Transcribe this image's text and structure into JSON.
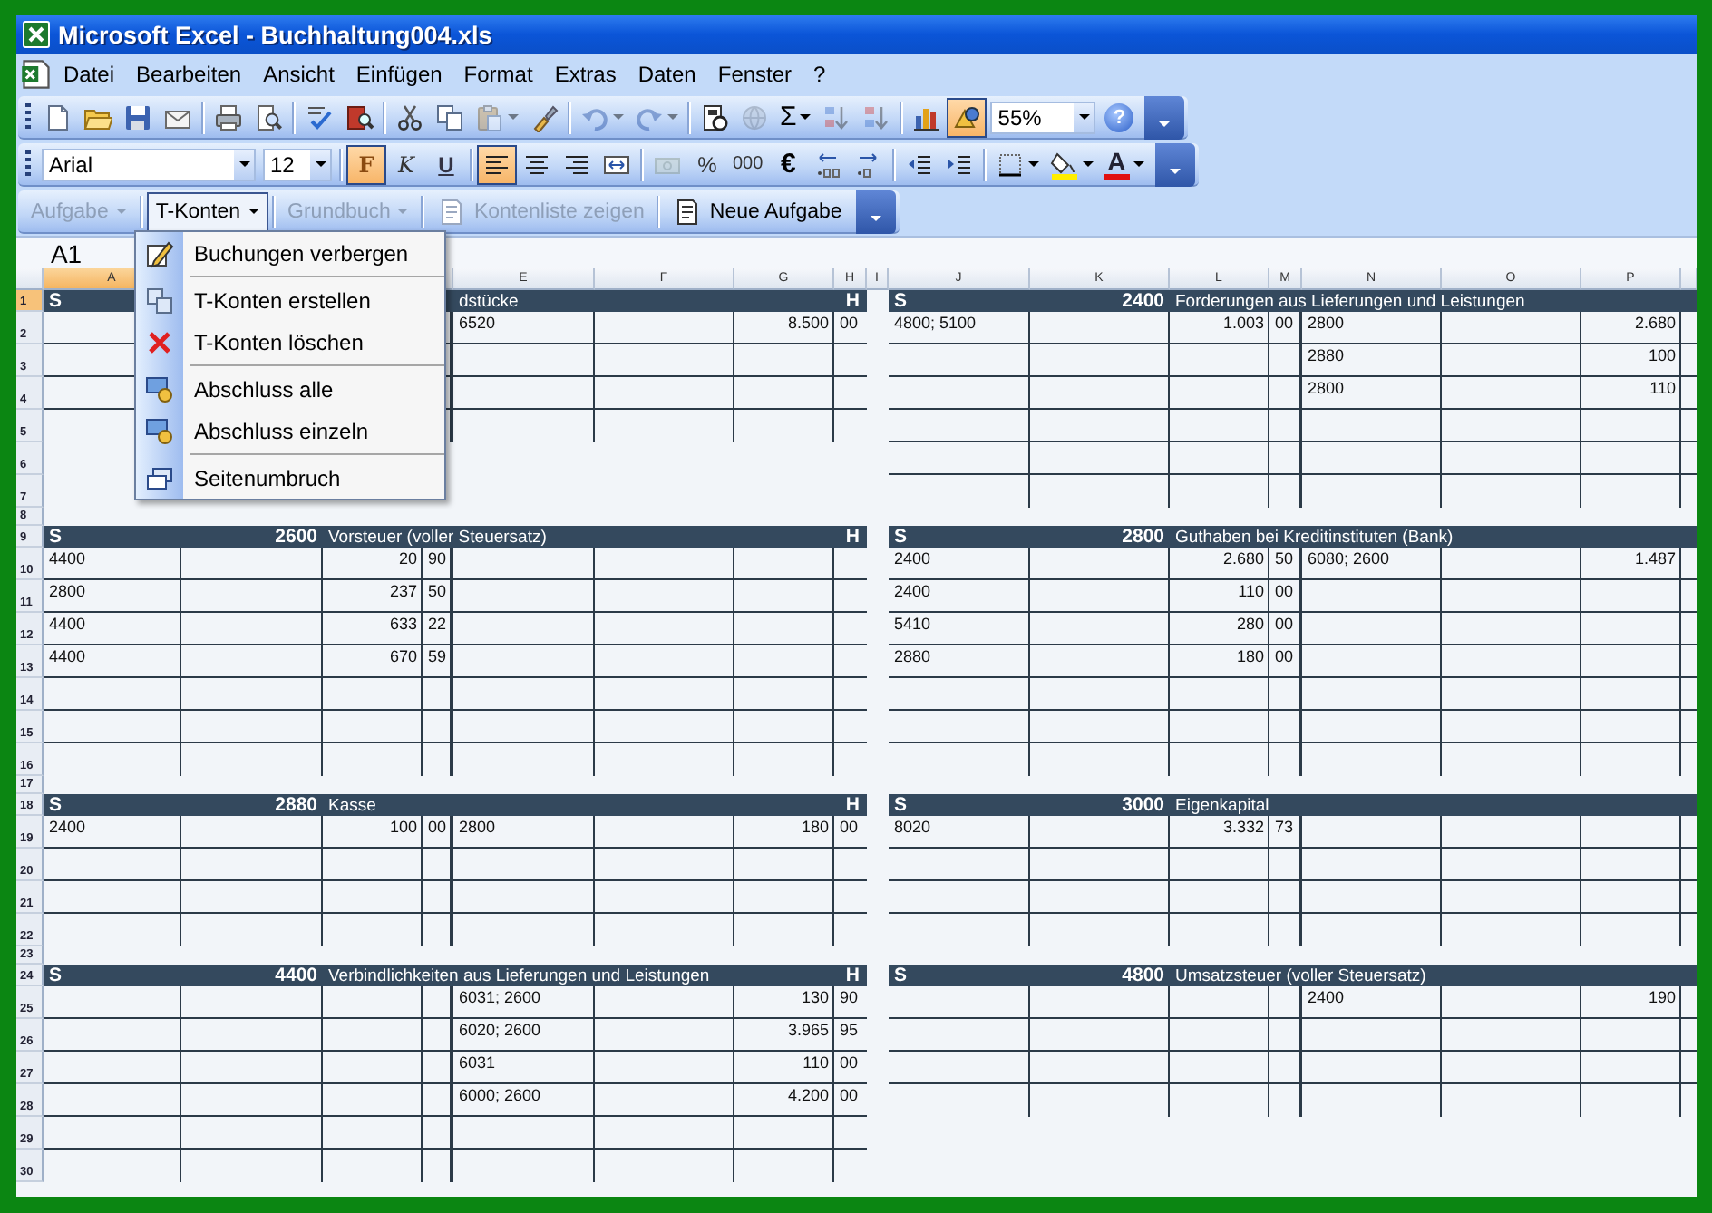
{
  "window": {
    "title": "Microsoft Excel - Buchhaltung004.xls"
  },
  "menu_bar": [
    "Datei",
    "Bearbeiten",
    "Ansicht",
    "Einfügen",
    "Format",
    "Extras",
    "Daten",
    "Fenster",
    "?"
  ],
  "standard_toolbar": {
    "zoom": "55%",
    "buttons": [
      {
        "kind": "icon",
        "pressed": false,
        "disabled": false,
        "dropdown": false
      },
      {
        "kind": "icon",
        "pressed": false,
        "disabled": false,
        "dropdown": false
      },
      {
        "kind": "icon",
        "pressed": false,
        "disabled": false,
        "dropdown": false
      },
      {
        "kind": "icon",
        "pressed": false,
        "disabled": false,
        "dropdown": false
      },
      {
        "kind": "icon",
        "pressed": false,
        "disabled": false,
        "dropdown": false
      },
      {
        "kind": "icon",
        "pressed": false,
        "disabled": false,
        "dropdown": false
      },
      {
        "kind": "icon",
        "pressed": false,
        "disabled": false,
        "dropdown": false
      },
      {
        "kind": "icon",
        "pressed": false,
        "disabled": false,
        "dropdown": false
      },
      {
        "kind": "icon",
        "pressed": false,
        "disabled": false,
        "dropdown": false
      },
      {
        "kind": "icon",
        "pressed": false,
        "disabled": false,
        "dropdown": false
      },
      {
        "kind": "icon",
        "pressed": false,
        "disabled": true,
        "dropdown": true
      },
      {
        "kind": "icon",
        "pressed": false,
        "disabled": false,
        "dropdown": false
      },
      {
        "kind": "icon",
        "pressed": false,
        "disabled": true,
        "dropdown": true
      },
      {
        "kind": "icon",
        "pressed": false,
        "disabled": true,
        "dropdown": true
      },
      {
        "kind": "icon",
        "pressed": false,
        "disabled": false,
        "dropdown": false
      },
      {
        "kind": "icon",
        "pressed": false,
        "disabled": true,
        "dropdown": false
      },
      {
        "kind": "text",
        "label": "Σ",
        "pressed": false,
        "disabled": false,
        "dropdown": true
      },
      {
        "kind": "icon",
        "pressed": false,
        "disabled": true,
        "dropdown": false
      },
      {
        "kind": "icon",
        "pressed": false,
        "disabled": true,
        "dropdown": false
      },
      {
        "kind": "icon",
        "pressed": false,
        "disabled": false,
        "dropdown": false
      },
      {
        "kind": "icon",
        "pressed": true,
        "disabled": false,
        "dropdown": false
      },
      {
        "kind": "round_text",
        "label": "?",
        "pressed": false,
        "disabled": false,
        "dropdown": false
      }
    ]
  },
  "formatting_toolbar": {
    "font": "Arial",
    "size": "12",
    "buttons": [
      {
        "kind": "text",
        "label": "F",
        "pressed": true,
        "disabled": false,
        "dropdown": false
      },
      {
        "kind": "text",
        "label": "K",
        "pressed": false,
        "disabled": false,
        "dropdown": false
      },
      {
        "kind": "text",
        "label": "U",
        "pressed": false,
        "disabled": false,
        "dropdown": false
      },
      {
        "kind": "icon",
        "pressed": true,
        "disabled": false,
        "dropdown": false
      },
      {
        "kind": "icon",
        "pressed": false,
        "disabled": false,
        "dropdown": false
      },
      {
        "kind": "icon",
        "pressed": false,
        "disabled": false,
        "dropdown": false
      },
      {
        "kind": "icon",
        "pressed": false,
        "disabled": false,
        "dropdown": false
      },
      {
        "kind": "icon",
        "pressed": false,
        "disabled": true,
        "dropdown": false
      },
      {
        "kind": "text",
        "label": "%",
        "pressed": false,
        "disabled": false,
        "dropdown": false
      },
      {
        "kind": "text",
        "label": "000",
        "pressed": false,
        "disabled": false,
        "dropdown": false
      },
      {
        "kind": "text",
        "label": "€",
        "pressed": false,
        "disabled": false,
        "dropdown": false
      },
      {
        "kind": "icon",
        "pressed": false,
        "disabled": false,
        "dropdown": false
      },
      {
        "kind": "icon",
        "pressed": false,
        "disabled": false,
        "dropdown": false
      },
      {
        "kind": "icon",
        "pressed": false,
        "disabled": false,
        "dropdown": false
      },
      {
        "kind": "icon",
        "pressed": false,
        "disabled": false,
        "dropdown": false
      },
      {
        "kind": "icon",
        "pressed": false,
        "disabled": false,
        "dropdown": true
      },
      {
        "kind": "icon",
        "pressed": false,
        "disabled": false,
        "dropdown": true
      },
      {
        "kind": "color_text",
        "label": "A",
        "pressed": false,
        "disabled": false,
        "dropdown": true
      }
    ]
  },
  "task_toolbar": {
    "buttons": [
      {
        "label": "Aufgabe",
        "icon": false,
        "dropdown": true,
        "disabled": true,
        "open": false
      },
      {
        "label": "T-Konten",
        "icon": false,
        "dropdown": true,
        "disabled": false,
        "open": true
      },
      {
        "label": "Grundbuch",
        "icon": false,
        "dropdown": true,
        "disabled": true,
        "open": false
      },
      {
        "label": "Kontenliste zeigen",
        "icon": true,
        "dropdown": false,
        "disabled": true,
        "open": false
      },
      {
        "label": "Neue Aufgabe",
        "icon": true,
        "dropdown": false,
        "disabled": false,
        "open": false
      }
    ]
  },
  "formula_bar": {
    "name_box": "A1"
  },
  "sheet": {
    "columns": [
      {
        "kind": "column",
        "label": "A",
        "selected": true
      },
      {
        "kind": "covered"
      },
      {
        "kind": "covered"
      },
      {
        "kind": "covered"
      },
      {
        "kind": "column",
        "label": "E",
        "selected": false
      },
      {
        "kind": "column",
        "label": "F",
        "selected": false
      },
      {
        "kind": "column",
        "label": "G",
        "selected": false
      },
      {
        "kind": "column",
        "label": "H",
        "selected": false
      },
      {
        "kind": "column",
        "label": "I",
        "selected": false
      },
      {
        "kind": "column",
        "label": "J",
        "selected": false
      },
      {
        "kind": "column",
        "label": "K",
        "selected": false
      },
      {
        "kind": "column",
        "label": "L",
        "selected": false
      },
      {
        "kind": "column",
        "label": "M",
        "selected": false
      },
      {
        "kind": "column",
        "label": "N",
        "selected": false
      },
      {
        "kind": "column",
        "label": "O",
        "selected": false
      },
      {
        "kind": "column",
        "label": "P",
        "selected": false
      }
    ],
    "rows": [
      {
        "label": "1",
        "selected": true
      },
      {
        "label": "2",
        "selected": false
      },
      {
        "label": "3",
        "selected": false
      },
      {
        "label": "4",
        "selected": false
      },
      {
        "label": "5",
        "selected": false
      },
      {
        "label": "6",
        "selected": false
      },
      {
        "label": "7",
        "selected": false
      },
      {
        "label": "8",
        "selected": false
      },
      {
        "label": "9",
        "selected": false
      },
      {
        "label": "10",
        "selected": false
      },
      {
        "label": "11",
        "selected": false
      },
      {
        "label": "12",
        "selected": false
      },
      {
        "label": "13",
        "selected": false
      },
      {
        "label": "14",
        "selected": false
      },
      {
        "label": "15",
        "selected": false
      },
      {
        "label": "16",
        "selected": false
      },
      {
        "label": "17",
        "selected": false
      },
      {
        "label": "18",
        "selected": false
      },
      {
        "label": "19",
        "selected": false
      },
      {
        "label": "20",
        "selected": false
      },
      {
        "label": "21",
        "selected": false
      },
      {
        "label": "22",
        "selected": false
      },
      {
        "label": "23",
        "selected": false
      },
      {
        "label": "24",
        "selected": false
      },
      {
        "label": "25",
        "selected": false
      },
      {
        "label": "26",
        "selected": false
      },
      {
        "label": "27",
        "selected": false
      },
      {
        "label": "28",
        "selected": false
      },
      {
        "label": "29",
        "selected": false
      },
      {
        "label": "30",
        "selected": false
      }
    ],
    "account_rows": [
      {
        "left": {
          "debit_side": "S",
          "credit_side": "H",
          "name": "dstücke",
          "name_covered": true,
          "lines": [
            {
              "kind": "entry",
              "credit": {
                "account": "6520",
                "amount": "8.500",
                "cents": "00"
              }
            },
            {
              "kind": "blank"
            },
            {
              "kind": "blank"
            },
            {
              "kind": "blank"
            }
          ]
        },
        "right": {
          "debit_side": "S",
          "number": "2400",
          "name": "Forderungen aus Lieferungen und Leistungen",
          "lines": [
            {
              "kind": "entry",
              "debit": {
                "account": "4800; 5100",
                "amount": "1.003",
                "cents": "00"
              },
              "credit": {
                "account": "2800",
                "amount": "2.680"
              }
            },
            {
              "kind": "entry",
              "credit": {
                "account": "2880",
                "amount": "100"
              }
            },
            {
              "kind": "entry",
              "credit": {
                "account": "2800",
                "amount": "110"
              }
            },
            {
              "kind": "blank"
            },
            {
              "kind": "blank"
            },
            {
              "kind": "blank"
            }
          ]
        }
      },
      {
        "left": {
          "debit_side": "S",
          "credit_side": "H",
          "number": "2600",
          "name": "Vorsteuer (voller Steuersatz)",
          "lines": [
            {
              "kind": "entry",
              "debit": {
                "account": "4400",
                "amount": "20",
                "cents": "90"
              }
            },
            {
              "kind": "entry",
              "debit": {
                "account": "2800",
                "amount": "237",
                "cents": "50"
              }
            },
            {
              "kind": "entry",
              "debit": {
                "account": "4400",
                "amount": "633",
                "cents": "22"
              }
            },
            {
              "kind": "entry",
              "debit": {
                "account": "4400",
                "amount": "670",
                "cents": "59"
              }
            },
            {
              "kind": "blank"
            },
            {
              "kind": "blank"
            },
            {
              "kind": "blank"
            }
          ]
        },
        "right": {
          "debit_side": "S",
          "number": "2800",
          "name": "Guthaben bei Kreditinstituten (Bank)",
          "lines": [
            {
              "kind": "entry",
              "debit": {
                "account": "2400",
                "amount": "2.680",
                "cents": "50"
              },
              "credit": {
                "account": "6080; 2600",
                "amount": "1.487"
              }
            },
            {
              "kind": "entry",
              "debit": {
                "account": "2400",
                "amount": "110",
                "cents": "00"
              }
            },
            {
              "kind": "entry",
              "debit": {
                "account": "5410",
                "amount": "280",
                "cents": "00"
              }
            },
            {
              "kind": "entry",
              "debit": {
                "account": "2880",
                "amount": "180",
                "cents": "00"
              }
            },
            {
              "kind": "blank"
            },
            {
              "kind": "blank"
            },
            {
              "kind": "blank"
            }
          ]
        }
      },
      {
        "left": {
          "debit_side": "S",
          "credit_side": "H",
          "number": "2880",
          "name": "Kasse",
          "lines": [
            {
              "kind": "entry",
              "debit": {
                "account": "2400",
                "amount": "100",
                "cents": "00"
              },
              "credit": {
                "account": "2800",
                "amount": "180",
                "cents": "00"
              }
            },
            {
              "kind": "blank"
            },
            {
              "kind": "blank"
            },
            {
              "kind": "blank"
            }
          ]
        },
        "right": {
          "debit_side": "S",
          "number": "3000",
          "name": "Eigenkapital",
          "lines": [
            {
              "kind": "entry",
              "debit": {
                "account": "8020",
                "amount": "3.332",
                "cents": "73"
              }
            },
            {
              "kind": "blank"
            },
            {
              "kind": "blank"
            },
            {
              "kind": "blank"
            }
          ]
        }
      },
      {
        "left": {
          "debit_side": "S",
          "credit_side": "H",
          "number": "4400",
          "name": "Verbindlichkeiten aus Lieferungen und Leistungen",
          "lines": [
            {
              "kind": "entry",
              "credit": {
                "account": "6031; 2600",
                "amount": "130",
                "cents": "90"
              }
            },
            {
              "kind": "entry",
              "credit": {
                "account": "6020; 2600",
                "amount": "3.965",
                "cents": "95"
              }
            },
            {
              "kind": "entry",
              "credit": {
                "account": "6031",
                "amount": "110",
                "cents": "00"
              }
            },
            {
              "kind": "entry",
              "credit": {
                "account": "6000; 2600",
                "amount": "4.200",
                "cents": "00"
              }
            },
            {
              "kind": "blank"
            },
            {
              "kind": "blank"
            }
          ]
        },
        "right": {
          "debit_side": "S",
          "number": "4800",
          "name": "Umsatzsteuer (voller Steuersatz)",
          "lines": [
            {
              "kind": "entry",
              "credit": {
                "account": "2400",
                "amount": "190"
              }
            },
            {
              "kind": "blank"
            },
            {
              "kind": "blank"
            },
            {
              "kind": "blank"
            }
          ]
        }
      }
    ]
  },
  "t_konten_menu": {
    "items": [
      {
        "kind": "item",
        "label": "Buchungen verbergen"
      },
      {
        "kind": "separator"
      },
      {
        "kind": "item",
        "label": "T-Konten erstellen"
      },
      {
        "kind": "item",
        "label": "T-Konten löschen"
      },
      {
        "kind": "separator"
      },
      {
        "kind": "item",
        "label": "Abschluss alle"
      },
      {
        "kind": "item",
        "label": "Abschluss einzeln"
      },
      {
        "kind": "separator"
      },
      {
        "kind": "item",
        "label": "Seitenumbruch"
      }
    ]
  }
}
